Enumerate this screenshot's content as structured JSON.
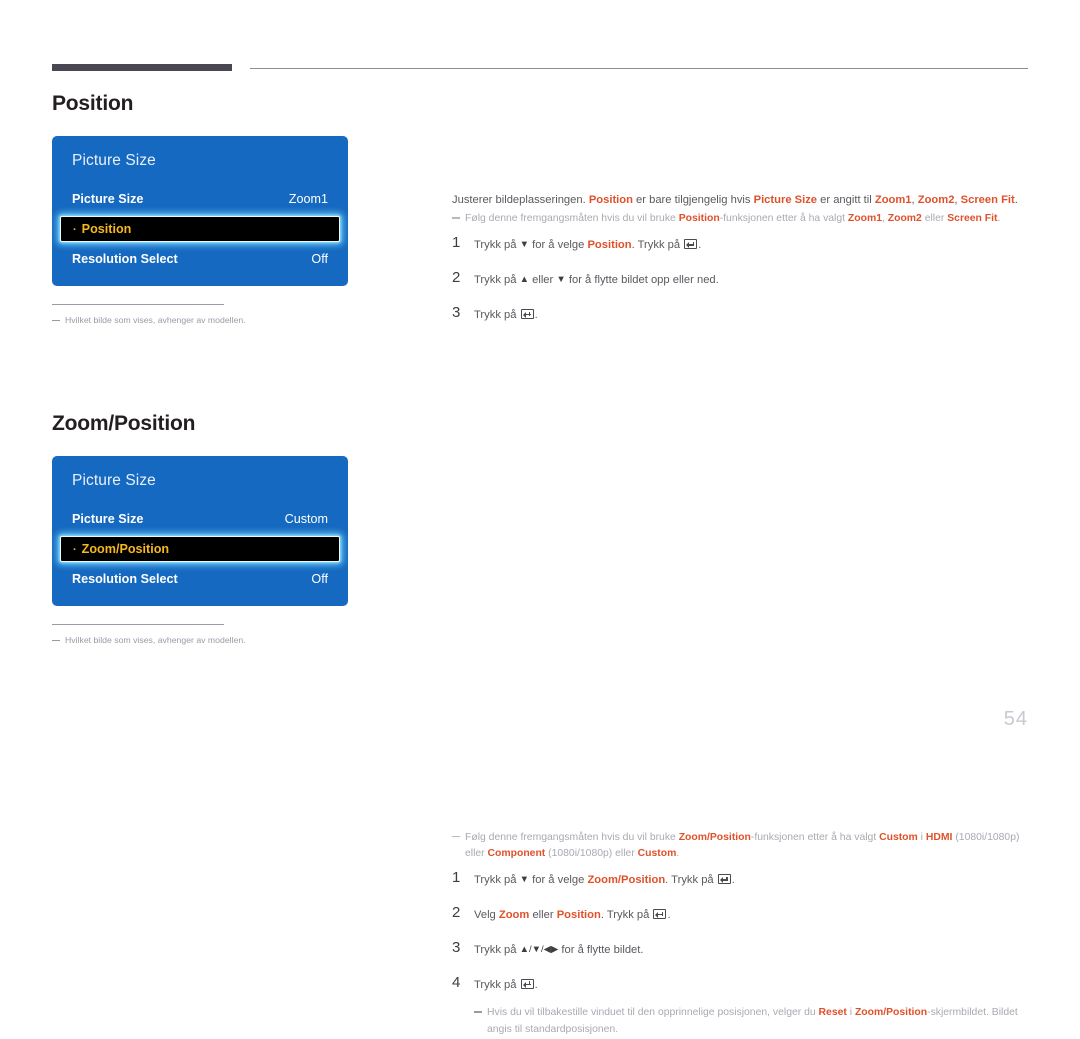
{
  "page": {
    "number": "54"
  },
  "sections": [
    {
      "heading": "Position",
      "osd": {
        "title": "Picture Size",
        "rows": [
          {
            "label": "Picture Size",
            "value": "Zoom1",
            "selected": false
          },
          {
            "label": "Position",
            "value": "",
            "selected": true
          },
          {
            "label": "Resolution Select",
            "value": "Off",
            "selected": false
          }
        ]
      },
      "footnote": "Hvilket bilde som vises, avhenger av modellen.",
      "lead_parts": [
        {
          "t": "Justerer bildeplasseringen. ",
          "s": "plain"
        },
        {
          "t": "Position",
          "s": "orange"
        },
        {
          "t": " er bare tilgjengelig hvis ",
          "s": "plain"
        },
        {
          "t": "Picture Size",
          "s": "orange"
        },
        {
          "t": " er angitt til ",
          "s": "plain"
        },
        {
          "t": "Zoom1",
          "s": "orange"
        },
        {
          "t": ", ",
          "s": "plain"
        },
        {
          "t": "Zoom2",
          "s": "orange"
        },
        {
          "t": ", ",
          "s": "plain"
        },
        {
          "t": "Screen Fit",
          "s": "orange"
        },
        {
          "t": ".",
          "s": "plain"
        }
      ],
      "note_parts": [
        {
          "t": "Følg denne fremgangsmåten hvis du vil bruke ",
          "s": "plain"
        },
        {
          "t": "Position",
          "s": "orange"
        },
        {
          "t": "-funksjonen etter å ha valgt ",
          "s": "plain"
        },
        {
          "t": "Zoom1",
          "s": "orange"
        },
        {
          "t": ", ",
          "s": "plain"
        },
        {
          "t": "Zoom2",
          "s": "orange"
        },
        {
          "t": " eller ",
          "s": "plain"
        },
        {
          "t": "Screen Fit",
          "s": "orange"
        },
        {
          "t": ".",
          "s": "plain"
        }
      ],
      "steps": [
        {
          "num": "1",
          "parts": [
            {
              "t": "Trykk på ",
              "s": "plain"
            },
            {
              "t": "▼",
              "s": "arrow"
            },
            {
              "t": " for å velge ",
              "s": "plain"
            },
            {
              "t": "Position",
              "s": "orange"
            },
            {
              "t": ". Trykk på ",
              "s": "plain"
            },
            {
              "t": "",
              "s": "enter"
            },
            {
              "t": ".",
              "s": "plain"
            }
          ]
        },
        {
          "num": "2",
          "parts": [
            {
              "t": "Trykk på ",
              "s": "plain"
            },
            {
              "t": "▲",
              "s": "arrow"
            },
            {
              "t": " eller ",
              "s": "plain"
            },
            {
              "t": "▼",
              "s": "arrow"
            },
            {
              "t": " for å flytte bildet opp eller ned.",
              "s": "plain"
            }
          ]
        },
        {
          "num": "3",
          "parts": [
            {
              "t": "Trykk på ",
              "s": "plain"
            },
            {
              "t": "",
              "s": "enter"
            },
            {
              "t": ".",
              "s": "plain"
            }
          ]
        }
      ],
      "sub_notes": []
    },
    {
      "heading": "Zoom/Position",
      "osd": {
        "title": "Picture Size",
        "rows": [
          {
            "label": "Picture Size",
            "value": "Custom",
            "selected": false
          },
          {
            "label": "Zoom/Position",
            "value": "",
            "selected": true
          },
          {
            "label": "Resolution Select",
            "value": "Off",
            "selected": false
          }
        ]
      },
      "footnote": "Hvilket bilde som vises, avhenger av modellen.",
      "lead_parts": [],
      "note_parts": [
        {
          "t": "Følg denne fremgangsmåten hvis du vil bruke ",
          "s": "plain"
        },
        {
          "t": "Zoom/Position",
          "s": "orange"
        },
        {
          "t": "-funksjonen etter å ha valgt ",
          "s": "plain"
        },
        {
          "t": "Custom",
          "s": "orange"
        },
        {
          "t": " i ",
          "s": "plain"
        },
        {
          "t": "HDMI",
          "s": "orange"
        },
        {
          "t": " (1080i/1080p) eller ",
          "s": "plain"
        },
        {
          "t": "Component",
          "s": "orange"
        },
        {
          "t": " (1080i/1080p) eller ",
          "s": "plain"
        },
        {
          "t": "Custom",
          "s": "orange"
        },
        {
          "t": ".",
          "s": "plain"
        }
      ],
      "steps": [
        {
          "num": "1",
          "parts": [
            {
              "t": "Trykk på ",
              "s": "plain"
            },
            {
              "t": "▼",
              "s": "arrow"
            },
            {
              "t": " for å velge ",
              "s": "plain"
            },
            {
              "t": "Zoom/Position",
              "s": "orange"
            },
            {
              "t": ". Trykk på ",
              "s": "plain"
            },
            {
              "t": "",
              "s": "enter"
            },
            {
              "t": ".",
              "s": "plain"
            }
          ]
        },
        {
          "num": "2",
          "parts": [
            {
              "t": "Velg ",
              "s": "plain"
            },
            {
              "t": "Zoom",
              "s": "orange"
            },
            {
              "t": " eller ",
              "s": "plain"
            },
            {
              "t": "Position",
              "s": "orange"
            },
            {
              "t": ". Trykk på ",
              "s": "plain"
            },
            {
              "t": "",
              "s": "enter"
            },
            {
              "t": ".",
              "s": "plain"
            }
          ]
        },
        {
          "num": "3",
          "parts": [
            {
              "t": "Trykk på ",
              "s": "plain"
            },
            {
              "t": "▲/▼/◀▶",
              "s": "arrow"
            },
            {
              "t": " for å flytte bildet.",
              "s": "plain"
            }
          ]
        },
        {
          "num": "4",
          "parts": [
            {
              "t": "Trykk på ",
              "s": "plain"
            },
            {
              "t": "",
              "s": "enter"
            },
            {
              "t": ".",
              "s": "plain"
            }
          ]
        }
      ],
      "sub_notes": [
        {
          "parts": [
            {
              "t": "Hvis du vil tilbakestille vinduet til den opprinnelige posisjonen, velger du ",
              "s": "plain"
            },
            {
              "t": "Reset",
              "s": "orange"
            },
            {
              "t": " i ",
              "s": "plain"
            },
            {
              "t": "Zoom/Position",
              "s": "orange"
            },
            {
              "t": "-skjermbildet. Bildet angis til standardposisjonen.",
              "s": "plain"
            }
          ]
        }
      ]
    }
  ],
  "colors": {
    "accent_orange": "#e0512a",
    "osd_blue": "#1569c0",
    "osd_highlight_text": "#f5b81f",
    "rule_dark": "#4a4753"
  }
}
